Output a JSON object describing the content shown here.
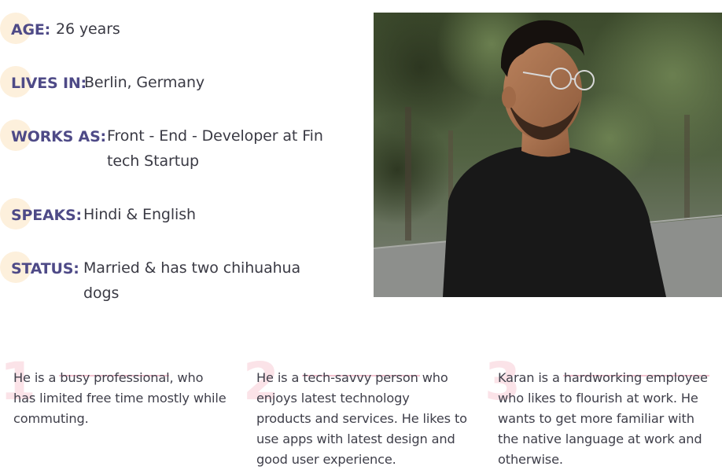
{
  "persona": {
    "facts": [
      {
        "label": "AGE:",
        "value": "26 years"
      },
      {
        "label": "LIVES IN:",
        "value": "Berlin, Germany"
      },
      {
        "label": "WORKS AS:",
        "value_line1": "Front - End - Developer at Fin",
        "value_line2": "tech Startup"
      },
      {
        "label": "SPEAKS:",
        "value": "Hindi & English"
      },
      {
        "label": "STATUS:",
        "value_line1": "Married & has two chihuahua",
        "value_line2": "dogs"
      }
    ]
  },
  "traits": [
    {
      "number": "1",
      "lines": [
        "He is a busy professional, who",
        "has limited free time mostly while",
        "commuting."
      ]
    },
    {
      "number": "2",
      "lines": [
        "He is a tech-savvy person who",
        "enjoys latest technology",
        "products and services. He likes to",
        "use apps with latest design and",
        "good user experience."
      ]
    },
    {
      "number": "3",
      "lines": [
        "Karan is a hardworking employee",
        "who likes to flourish at work. He",
        "wants to get more familiar with",
        "the native language at work and",
        "otherwise."
      ]
    }
  ],
  "colors": {
    "label": "#4e4a87",
    "dot": "#fdf0dc",
    "number": "#fbe3e8",
    "highlight": "#f3c2cf"
  }
}
